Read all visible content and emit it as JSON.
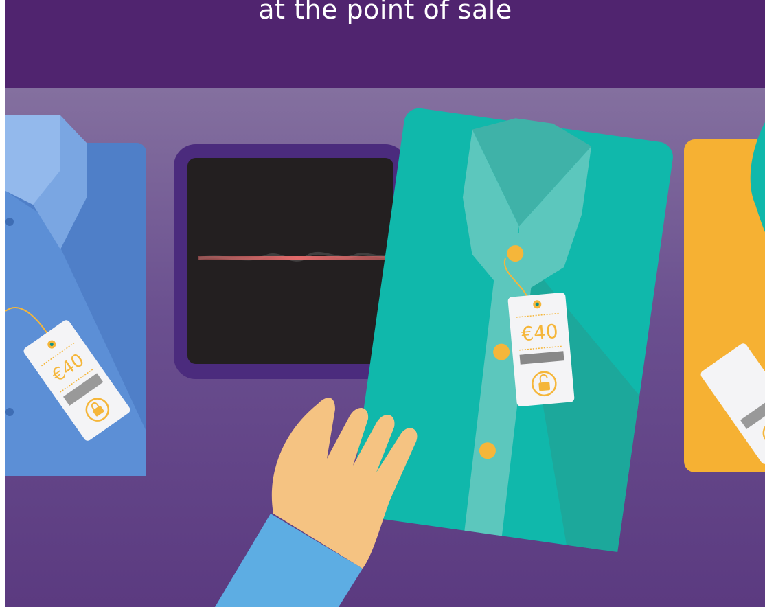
{
  "header": {
    "headline": "at the point of sale"
  },
  "scene": {
    "tags": {
      "left_price": "€40",
      "center_price": "€40"
    },
    "icons": {
      "lock_closed": "padlock-closed-icon",
      "lock_open": "padlock-open-icon"
    },
    "colors": {
      "band": "#50246f",
      "background_top": "#84709f",
      "background_bottom": "#5b3a80",
      "blue_shirt": "#4f7fc8",
      "teal_shirt": "#10b8ab",
      "yellow_shirt": "#f6b133",
      "accent": "#f5b63a",
      "sleeve": "#5dade3",
      "hand": "#f5c382",
      "scanner_frame": "#4b2b7d",
      "scanner_screen": "#231f20",
      "laser": "#e36b6b"
    }
  }
}
